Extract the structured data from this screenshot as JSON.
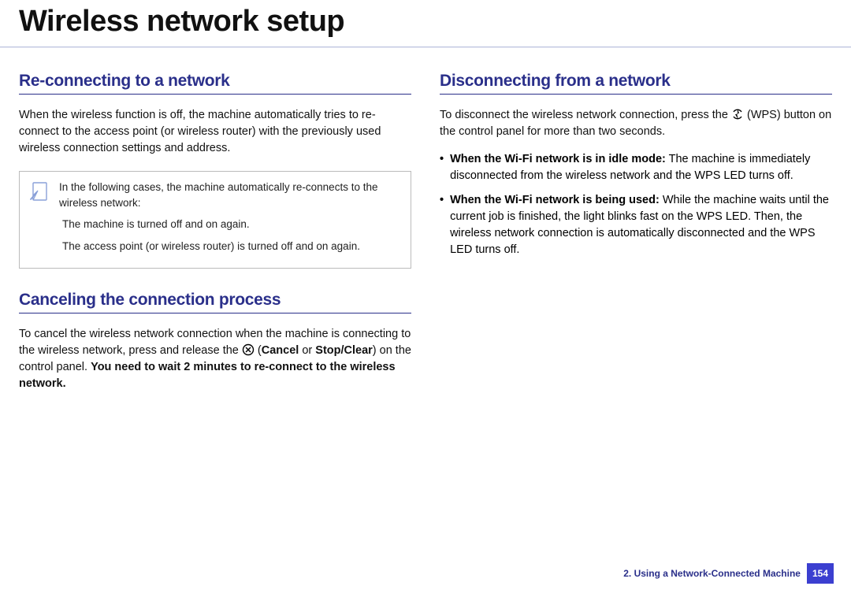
{
  "title": "Wireless network setup",
  "left": {
    "section1": {
      "heading": "Re-connecting to a network",
      "p1": "When the wireless function is off, the machine automatically tries to re-connect to the access point (or wireless router) with the previously used wireless connection settings and address.",
      "note_intro": "In the following cases, the machine automatically re-connects to the wireless network:",
      "note_a": "The machine is turned off and on again.",
      "note_b": "The access point (or wireless router) is turned off and on again."
    },
    "section2": {
      "heading": "Canceling the connection process",
      "p1a": "To cancel the wireless network connection when the machine is connecting to the wireless network, press and release the ",
      "p1b_cancel": "Cancel",
      "p1c_or": " or ",
      "p1d_stop": "Stop/Clear",
      "p1e": ") on the control panel. ",
      "p1f_bold": "You need to wait 2 minutes to re-connect to the wireless network."
    }
  },
  "right": {
    "section1": {
      "heading": "Disconnecting from a network",
      "p1a": "To disconnect the wireless network connection, press the ",
      "p1b": " (WPS) button on the control panel for more than two seconds.",
      "b1_label": "When the Wi-Fi network is in idle mode:",
      "b1_text": " The machine is immediately disconnected from the wireless network and the WPS LED turns off.",
      "b2_label": "When the Wi-Fi network is being used:",
      "b2_text": " While the machine waits until the current job is finished, the light blinks fast on the WPS LED. Then, the wireless network connection is automatically disconnected and the WPS LED turns off."
    }
  },
  "footer": {
    "chapter": "2.  Using a Network-Connected Machine",
    "page": "154"
  }
}
